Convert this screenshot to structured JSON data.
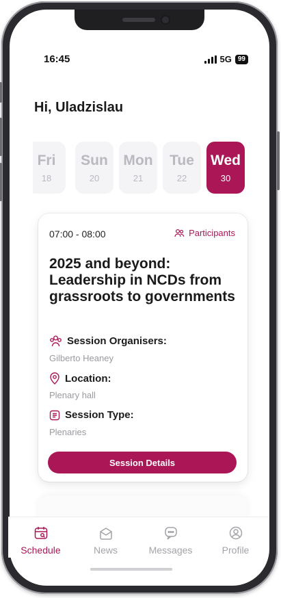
{
  "status_bar": {
    "time": "16:45",
    "network": "5G",
    "battery": "99"
  },
  "greeting": "Hi, Uladzislau",
  "days": [
    {
      "name": "Fri",
      "date": "18"
    },
    {
      "name": "Sun",
      "date": "20"
    },
    {
      "name": "Mon",
      "date": "21"
    },
    {
      "name": "Tue",
      "date": "22"
    },
    {
      "name": "Wed",
      "date": "30"
    }
  ],
  "session": {
    "time": "07:00 - 08:00",
    "participants_label": "Participants",
    "title": "2025 and beyond: Leadership in NCDs from grassroots to governments",
    "organisers_label": "Session Organisers:",
    "organisers": "Gilberto Heaney",
    "location_label": "Location:",
    "location": "Plenary hall",
    "type_label": "Session Type:",
    "type": "Plenaries",
    "details_button": "Session Details"
  },
  "tabs": [
    {
      "label": "Schedule",
      "icon": "calendar-icon",
      "active": true
    },
    {
      "label": "News",
      "icon": "news-icon",
      "active": false
    },
    {
      "label": "Messages",
      "icon": "message-icon",
      "active": false
    },
    {
      "label": "Profile",
      "icon": "profile-icon",
      "active": false
    }
  ],
  "colors": {
    "accent": "#ab1656",
    "muted": "#a3a3a8"
  }
}
